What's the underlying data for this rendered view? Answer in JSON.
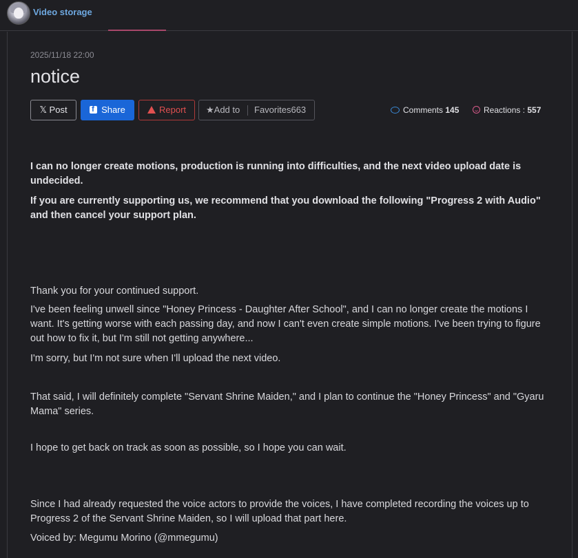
{
  "header": {
    "site_title": "Video storage",
    "avatar_icon": "avatar-icon"
  },
  "post": {
    "date": "2025/11/18 22:00",
    "title": "notice"
  },
  "actions": {
    "post_label": "Post",
    "post_glyph": "𝕏",
    "share_label": "Share",
    "report_label": "Report",
    "add_to_label": "Add to",
    "favorites_label": "Favorites663",
    "star_glyph": "★"
  },
  "stats": {
    "comments_label": "Comments",
    "comments_count": "145",
    "reactions_label": "Reactions :",
    "reactions_count": "557"
  },
  "body": {
    "p1": "I can no longer create motions, production is running into difficulties, and the next video upload date is undecided.",
    "p2": "If you are currently supporting us, we recommend that you download the following \"Progress 2 with Audio\" and then cancel your support plan.",
    "p3": "Thank you for your continued support.",
    "p4": "I've been feeling unwell since \"Honey Princess - Daughter After School\", and I can no longer create the motions I want. It's getting worse with each passing day, and now I can't even create simple motions. I've been trying to figure out how to fix it, but I'm still not getting anywhere...",
    "p5": "I'm sorry, but I'm not sure when I'll upload the next video.",
    "p6": "That said, I will definitely complete \"Servant Shrine Maiden,\" and I plan to continue the \"Honey Princess\" and \"Gyaru Mama\" series.",
    "p7": "I hope to get back on track as soon as possible, so I hope you can wait.",
    "p8": "Since I had already requested the voice actors to provide the voices, I have completed recording the voices up to Progress 2 of the Servant Shrine Maiden, so I will upload that part here.",
    "p9": "Voiced by: Megumu Morino (@mmegumu)"
  },
  "colors": {
    "accent_link": "#6ea8e0",
    "share_bg": "#1a66d8",
    "report": "#e05050",
    "comment_icon": "#3a8ad8",
    "reaction_icon": "#d85a8a",
    "tab_underline": "#a8486a"
  }
}
